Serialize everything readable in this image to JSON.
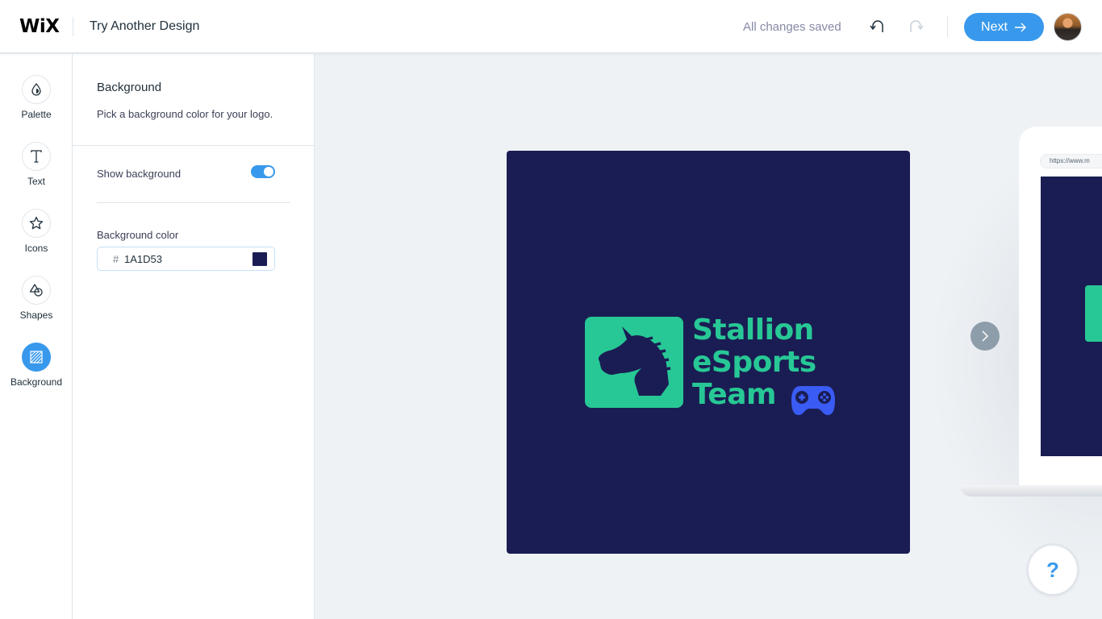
{
  "header": {
    "logo_text": "WiX",
    "page_title": "Try Another Design",
    "save_status": "All changes saved",
    "undo_icon": "undo-icon",
    "redo_icon": "redo-icon",
    "next_label": "Next",
    "next_icon": "arrow-right-icon",
    "avatar": "user-avatar"
  },
  "rail": {
    "items": [
      {
        "label": "Palette",
        "icon": "palette-drop-icon",
        "active": false
      },
      {
        "label": "Text",
        "icon": "text-icon",
        "active": false
      },
      {
        "label": "Icons",
        "icon": "star-icon",
        "active": false
      },
      {
        "label": "Shapes",
        "icon": "shapes-icon",
        "active": false
      },
      {
        "label": "Background",
        "icon": "background-hatch-icon",
        "active": true
      }
    ]
  },
  "panel": {
    "title": "Background",
    "description": "Pick a background color for your logo.",
    "show_background_label": "Show background",
    "show_background_on": true,
    "color_label": "Background color",
    "color_prefix": "#",
    "color_value": "1A1D53"
  },
  "colors": {
    "accent": "#3899ec",
    "logo_background": "#1a1d53",
    "logo_primary": "#27c895",
    "logo_secondary": "#3a5cf5",
    "nav_arrow": "#8e9daa"
  },
  "canvas": {
    "logo_lines": [
      "Stallion",
      "eSports",
      "Team"
    ],
    "logo_mark_icon": "horse-head-icon",
    "logo_extra_icon": "gamepad-icon",
    "next_design_icon": "chevron-right-icon",
    "mockup_url": "https://www.m",
    "help_label": "?"
  }
}
